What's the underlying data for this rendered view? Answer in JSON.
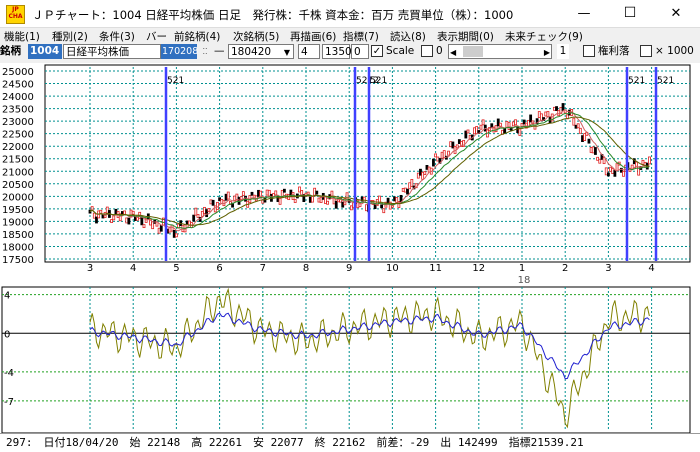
{
  "window": {
    "icon_text": "JP CHA",
    "title": "ＪＰチャート：1004 日経平均株価 日足　発行株：千株 資本金：百万 売買単位（株）：1000",
    "minimize": "—",
    "maximize": "☐",
    "close": "✕"
  },
  "menu": [
    {
      "label": "機能(1)"
    },
    {
      "label": "種別(2)"
    },
    {
      "label": "条件(3)"
    },
    {
      "label": "バー"
    },
    {
      "label": "前銘柄(4)"
    },
    {
      "label": "次銘柄(5)"
    },
    {
      "label": "再描画(6)"
    },
    {
      "label": "指標(7)"
    },
    {
      "label": "読込(8)"
    },
    {
      "label": "表示期間(0)"
    },
    {
      "label": "未来チェック(9)"
    }
  ],
  "toolbar": {
    "code_label": "銘柄",
    "code": "1004",
    "name": "日経平均株価",
    "value": "170208",
    "dash": "—",
    "date": "180420",
    "num1": "4",
    "num2": "1350",
    "num3": "0",
    "scale_label": "Scale",
    "scale_value": "0",
    "spin_value": "1",
    "rights_label": "権利落",
    "mult_label": "× 1000"
  },
  "price_axis": [
    "25000",
    "24500",
    "24000",
    "23500",
    "23000",
    "22500",
    "22000",
    "21500",
    "21000",
    "20500",
    "20000",
    "19500",
    "19000",
    "18500",
    "18000",
    "17500"
  ],
  "month_labels": [
    {
      "text": "3"
    },
    {
      "text": "4"
    },
    {
      "text": "5"
    },
    {
      "text": "6"
    },
    {
      "text": "7"
    },
    {
      "text": "8"
    },
    {
      "text": "9"
    },
    {
      "text": "10"
    },
    {
      "text": "11"
    },
    {
      "text": "12"
    },
    {
      "text": "1"
    },
    {
      "text": "2"
    },
    {
      "text": "3"
    },
    {
      "text": "4"
    }
  ],
  "year_label": "18",
  "event_marks": [
    {
      "label": "521",
      "color": "#4040ff"
    },
    {
      "label": "5212",
      "color": "#4040ff"
    },
    {
      "label": "521",
      "color": "#4040ff"
    },
    {
      "label": "521",
      "color": "#4040ff"
    },
    {
      "label": "521",
      "color": "#4040ff"
    }
  ],
  "indicator_axis": [
    "4",
    "0",
    "-4",
    "-7"
  ],
  "colors": {
    "ma_fast": "#d06060",
    "ma_mid": "#2a8a2a",
    "ma_slow": "#606000",
    "osc_fast": "#808000",
    "osc_slow": "#2020d0",
    "grid": "#009090",
    "event_line": "#4040ff"
  },
  "chart_data": [
    {
      "type": "line",
      "title": "",
      "xlabel": "",
      "ylabel": "",
      "ylim": [
        17500,
        25000
      ],
      "x": [
        "2017-03",
        "2017-04",
        "2017-05",
        "2017-06",
        "2017-07",
        "2017-08",
        "2017-09",
        "2017-10",
        "2017-11",
        "2017-12",
        "2018-01",
        "2018-02",
        "2018-03",
        "2018-04"
      ],
      "series": [
        {
          "values": [
            19300,
            19200,
            18600,
            19800,
            20000,
            20050,
            19750,
            19650,
            21400,
            22700,
            22800,
            23500,
            21000,
            21300
          ]
        }
      ]
    },
    {
      "type": "line",
      "title": "",
      "ylim": [
        -9.5,
        5
      ],
      "x": [
        "2017-03",
        "2017-04",
        "2017-05",
        "2017-06",
        "2017-07",
        "2017-08",
        "2017-09",
        "2017-10",
        "2017-11",
        "2017-12",
        "2018-01",
        "2018-02",
        "2018-03",
        "2018-04"
      ],
      "series": [
        {
          "values": [
            0.4,
            -0.5,
            -1.5,
            3.5,
            0.2,
            -0.8,
            0.5,
            1.5,
            2.0,
            -0.5,
            1.0,
            -8.5,
            1.5,
            2.0
          ]
        },
        {
          "values": [
            0.2,
            -0.4,
            -1.2,
            2.0,
            0.3,
            -0.3,
            0.4,
            1.2,
            1.6,
            -0.2,
            0.8,
            -4.5,
            0.6,
            1.5
          ]
        }
      ]
    }
  ],
  "status": {
    "text": "297:　日付18/04/20　始 22148　高 22261　安 22077　終 22162　前差：-29　出 142499　指標21539.21"
  }
}
